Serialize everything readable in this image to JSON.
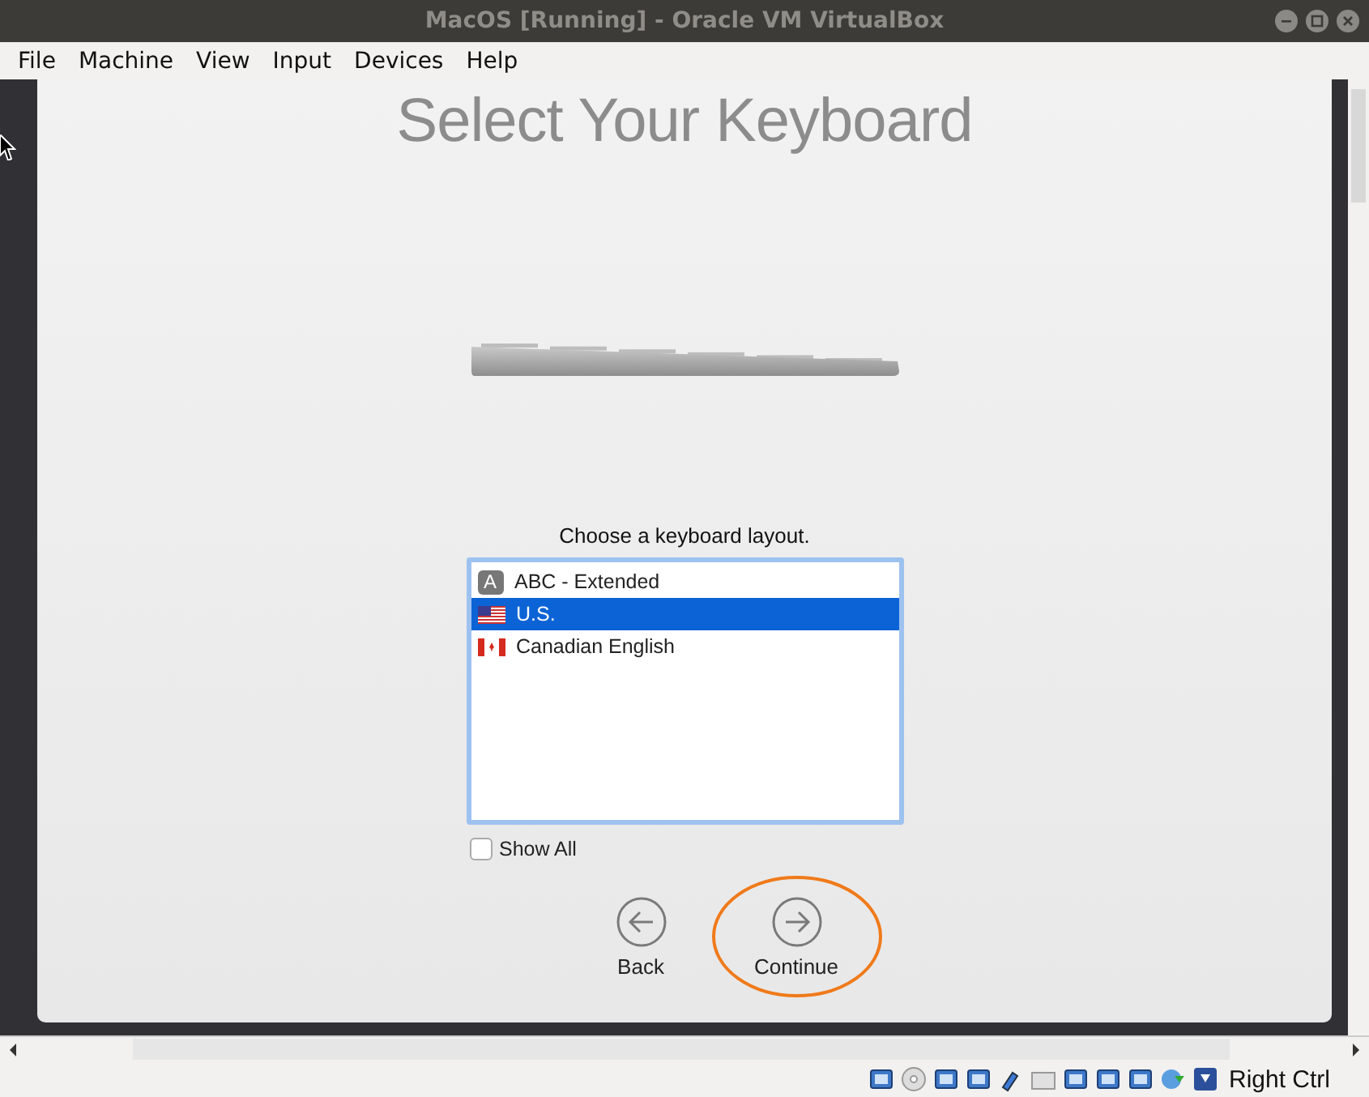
{
  "window": {
    "title": "MacOS [Running] - Oracle VM VirtualBox"
  },
  "menu": [
    "File",
    "Machine",
    "View",
    "Input",
    "Devices",
    "Help"
  ],
  "setup": {
    "title": "Select Your Keyboard",
    "prompt": "Choose a keyboard layout.",
    "layouts": [
      {
        "kind": "letter",
        "glyph": "A",
        "label": "ABC - Extended",
        "selected": false
      },
      {
        "kind": "us",
        "label": "U.S.",
        "selected": true
      },
      {
        "kind": "ca",
        "label": "Canadian English",
        "selected": false
      }
    ],
    "show_all": {
      "label": "Show All",
      "checked": false
    },
    "buttons": [
      {
        "kind": "back",
        "label": "Back",
        "highlighted": false
      },
      {
        "kind": "continue",
        "label": "Continue",
        "highlighted": true
      }
    ]
  },
  "status_bar": {
    "host_key": "Right Ctrl"
  }
}
